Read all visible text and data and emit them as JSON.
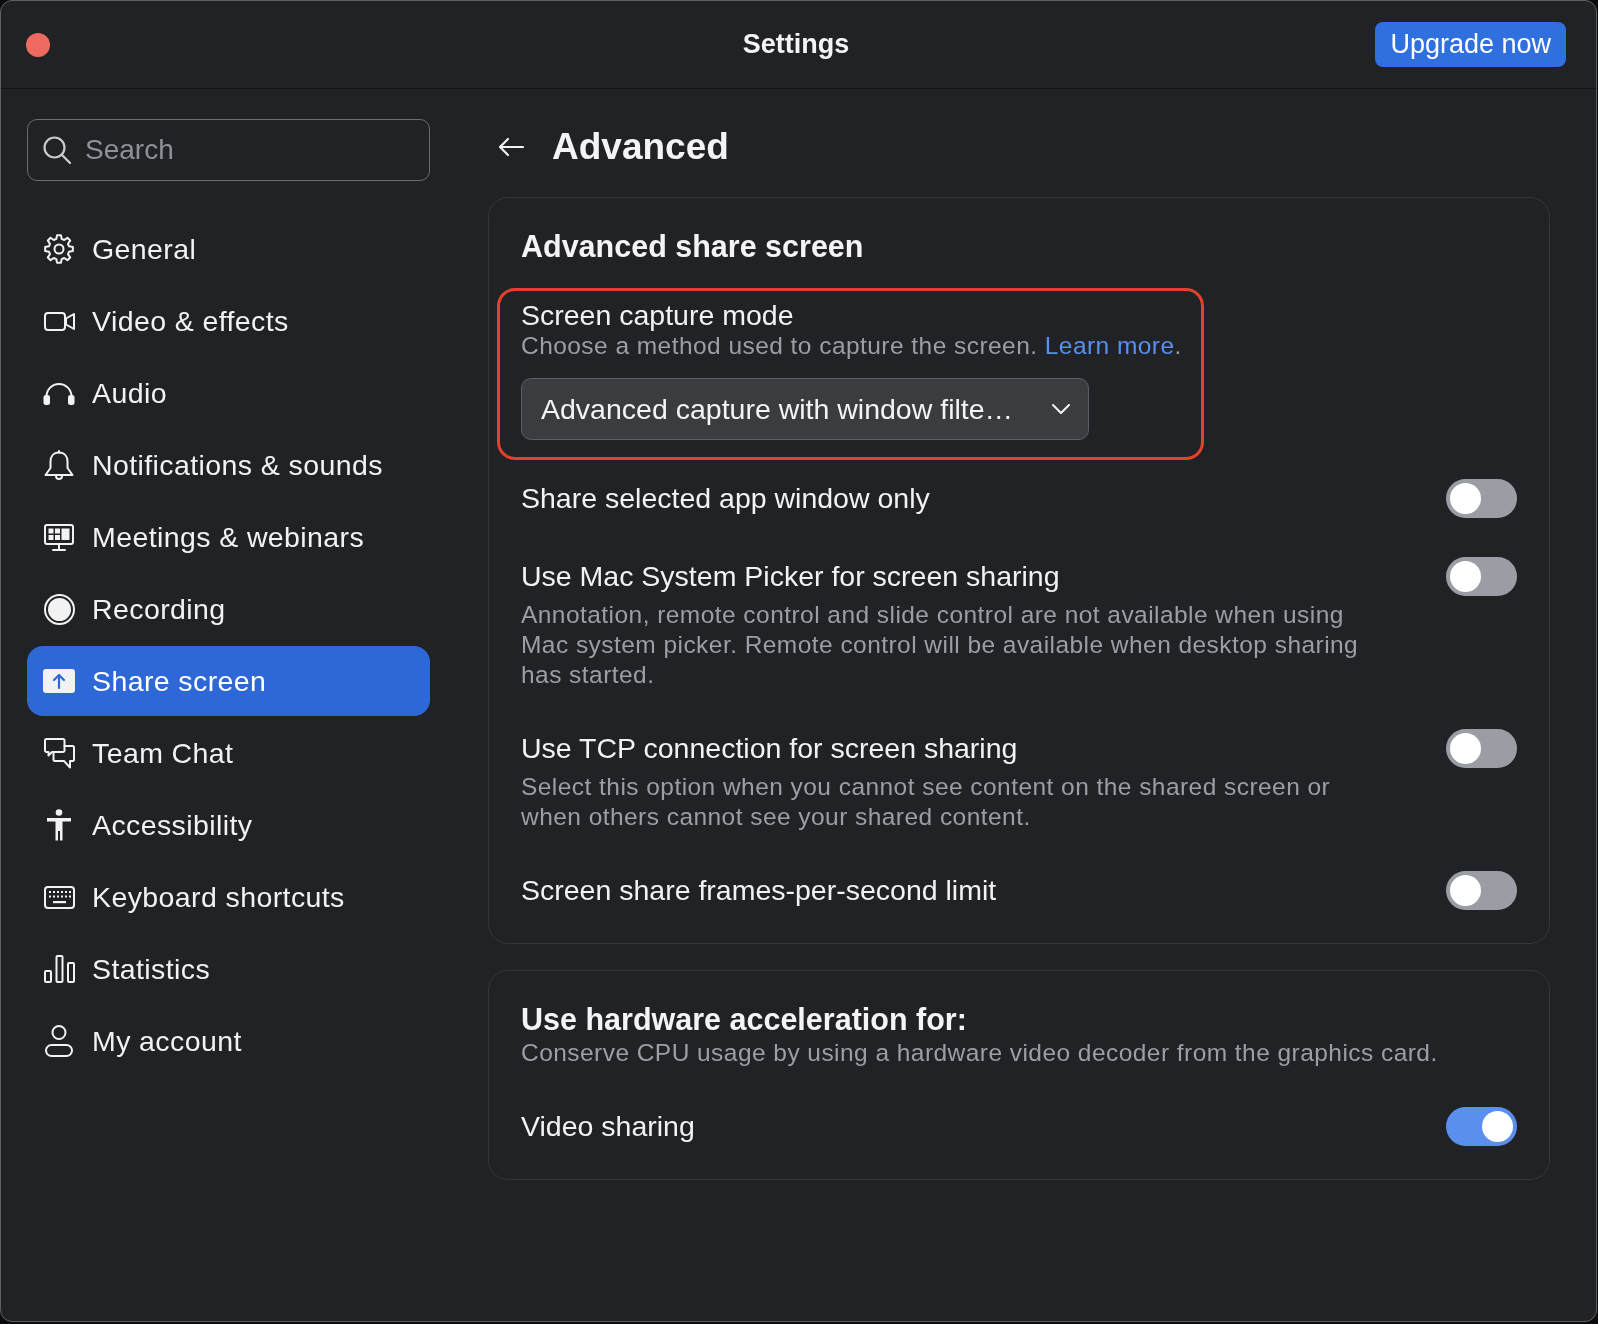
{
  "window": {
    "title": "Settings",
    "upgrade_button": "Upgrade now"
  },
  "sidebar": {
    "search": {
      "placeholder": "Search"
    },
    "items": [
      {
        "label": "General",
        "selected": false
      },
      {
        "label": "Video & effects",
        "selected": false
      },
      {
        "label": "Audio",
        "selected": false
      },
      {
        "label": "Notifications & sounds",
        "selected": false
      },
      {
        "label": "Meetings & webinars",
        "selected": false
      },
      {
        "label": "Recording",
        "selected": false
      },
      {
        "label": "Share screen",
        "selected": true
      },
      {
        "label": "Team Chat",
        "selected": false
      },
      {
        "label": "Accessibility",
        "selected": false
      },
      {
        "label": "Keyboard shortcuts",
        "selected": false
      },
      {
        "label": "Statistics",
        "selected": false
      },
      {
        "label": "My account",
        "selected": false
      }
    ]
  },
  "page": {
    "title": "Advanced"
  },
  "sections": [
    {
      "title": "Advanced share screen",
      "settings": [
        {
          "kind": "dropdown",
          "label": "Screen capture mode",
          "description": "Choose a method used to capture the screen.",
          "link": "Learn more",
          "after_link": ".",
          "value": "Advanced capture with window filte…",
          "highlighted": true
        },
        {
          "kind": "toggle",
          "label": "Share selected app window only",
          "on": false
        },
        {
          "kind": "toggle",
          "label": "Use Mac System Picker for screen sharing",
          "description": "Annotation, remote control and slide control are not available when using Mac system picker. Remote control will be available when desktop sharing has started.",
          "on": false
        },
        {
          "kind": "toggle",
          "label": "Use TCP connection for screen sharing",
          "description": "Select this option when you cannot see content on the shared screen or when others cannot see your shared content.",
          "on": false
        },
        {
          "kind": "toggle",
          "label": "Screen share frames-per-second limit",
          "on": false
        }
      ]
    },
    {
      "title": "Use hardware acceleration for:",
      "description": "Conserve CPU usage by using a hardware video decoder from the graphics card.",
      "settings": [
        {
          "kind": "toggle",
          "label": "Video sharing",
          "on": true
        }
      ]
    }
  ]
}
